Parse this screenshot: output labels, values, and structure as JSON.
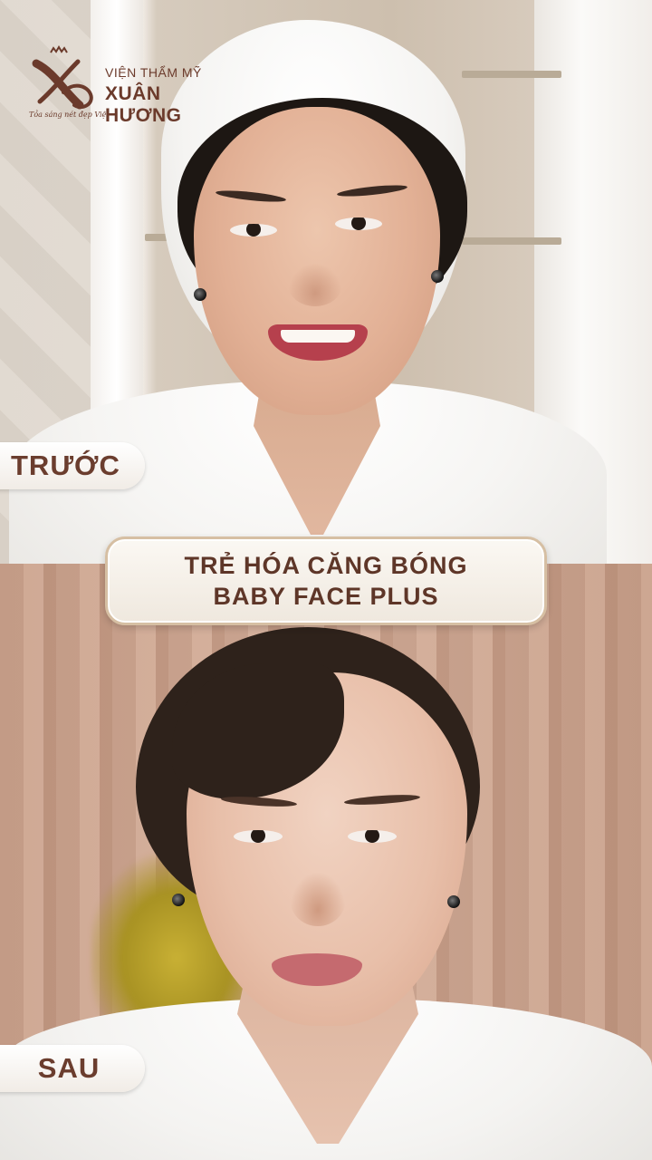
{
  "brand": {
    "line1": "VIỆN THẨM MỸ",
    "line2": "XUÂN HƯƠNG",
    "tagline": "Tỏa sáng nét đẹp Việt",
    "logo_icon": "xh-monogram-icon",
    "color": "#6b3a2b"
  },
  "labels": {
    "before": "TRƯỚC",
    "after": "SAU"
  },
  "banner": {
    "line1": "TRẺ HÓA CĂNG BÓNG",
    "line2": "BABY FACE PLUS"
  },
  "colors": {
    "label_text": "#6b3d2e",
    "banner_border": "#d6bfa3"
  }
}
